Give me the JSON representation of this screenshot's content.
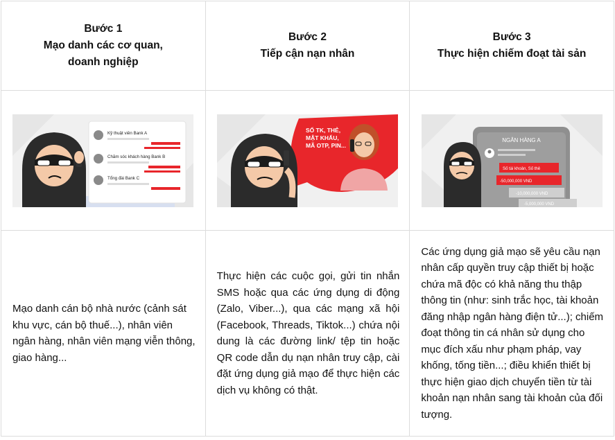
{
  "steps": [
    {
      "title": "Bước 1",
      "subtitle": "Mạo danh các cơ quan, doanh nghiệp",
      "image": {
        "contacts": [
          "Kỹ thuật viên Bank A",
          "Chăm sóc khách hàng Bank B",
          "Tổng đài Bank C"
        ]
      },
      "description": "Mạo danh cán bộ nhà nước (cảnh sát khu vực, cán bộ thuế...), nhân viên ngân hàng, nhân viên mạng viễn thông, giao hàng..."
    },
    {
      "title": "Bước 2",
      "subtitle": "Tiếp cận nạn nhân",
      "image": {
        "bubble_lines": [
          "SỐ TK, THẺ,",
          "MẬT KHẨU,",
          "MÃ OTP, PIN..."
        ]
      },
      "description": "Thực hiện các cuộc gọi, gửi tin nhắn SMS hoặc qua các ứng dụng di động (Zalo, Viber...), qua các mạng xã hội (Facebook, Threads, Tiktok...) chứa nội dung là các đường link/ tệp tin hoặc QR code dẫn dụ nạn nhân truy cập, cài đặt ứng dụng giả mạo để thực hiện các dịch vụ không có thật."
    },
    {
      "title": "Bước 3",
      "subtitle": "Thực hiện chiếm đoạt tài sản",
      "image": {
        "phone_title": "NGÂN HÀNG A",
        "messages": [
          "Số tài khoản, Số thẻ",
          "-50,000,000 VND",
          "-10,000,000 VND",
          "-5,000,000 VND"
        ]
      },
      "description": "Các ứng dụng giả mạo sẽ yêu cầu nạn nhân cấp quyền truy cập thiết bị hoặc chứa mã độc có khả năng thu thập thông tin (như: sinh trắc học, tài khoản đăng nhập ngân hàng điện tử...); chiếm đoạt thông tin cá nhân sử dụng cho mục đích xấu như phạm pháp, vay khống, tống tiền...; điều khiển thiết bị thực hiện giao dịch chuyển tiền từ tài khoản nạn nhân sang tài khoản của đối tượng."
    }
  ],
  "colors": {
    "accent_red": "#e8262b",
    "hood": "#2b2b2b",
    "bg_gray": "#efefef"
  }
}
